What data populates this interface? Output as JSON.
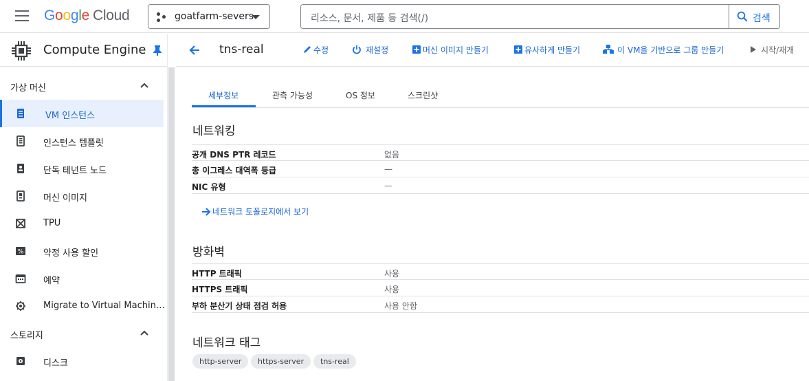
{
  "topbar": {
    "logo": {
      "g": "G",
      "o1": "o",
      "o2": "o",
      "g2": "g",
      "l": "l",
      "e": "e",
      "cloud": "Cloud"
    },
    "project": "goatfarm-severs",
    "search_placeholder": "리소스, 문서, 제품 등 검색(/)",
    "search_button": "검색"
  },
  "sidebar": {
    "product": "Compute Engine",
    "sections": [
      {
        "title": "가상 머신"
      },
      {
        "title": "스토리지"
      }
    ],
    "items": [
      {
        "label": "VM 인스턴스",
        "icon": "vm-instance-icon"
      },
      {
        "label": "인스턴스 템플릿",
        "icon": "template-icon"
      },
      {
        "label": "단독 테넌트 노드",
        "icon": "sole-tenant-icon"
      },
      {
        "label": "머신 이미지",
        "icon": "machine-image-icon"
      },
      {
        "label": "TPU",
        "icon": "tpu-icon"
      },
      {
        "label": "약정 사용 할인",
        "icon": "discount-icon"
      },
      {
        "label": "예약",
        "icon": "calendar-icon"
      },
      {
        "label": "Migrate to Virtual Machin…",
        "icon": "migrate-icon"
      },
      {
        "label": "디스크",
        "icon": "disk-icon"
      }
    ]
  },
  "header": {
    "title": "tns-real",
    "actions": {
      "edit": "수정",
      "reset": "재설정",
      "create_image": "머신 이미지 만들기",
      "create_similar": "유사하게 만들기",
      "create_group": "이 VM을 기반으로 그룹 만들기",
      "start": "시작/재개"
    }
  },
  "tabs": [
    "세부정보",
    "관측 가능성",
    "OS 정보",
    "스크린샷"
  ],
  "networking": {
    "title": "네트워킹",
    "rows": [
      {
        "key": "공개 DNS PTR 레코드",
        "value": "없음"
      },
      {
        "key": "총 이그레스 대역폭 등급",
        "value": "—"
      },
      {
        "key": "NIC 유형",
        "value": "—"
      }
    ],
    "topology_link": "네트워크 토폴로지에서 보기"
  },
  "firewall": {
    "title": "방화벽",
    "rows": [
      {
        "key": "HTTP 트래픽",
        "value": "사용"
      },
      {
        "key": "HTTPS 트래픽",
        "value": "사용"
      },
      {
        "key": "부하 분산기 상태 점검 허용",
        "value": "사용 안함"
      }
    ]
  },
  "network_tags": {
    "title": "네트워크 태그",
    "tags": [
      "http-server",
      "https-server",
      "tns-real"
    ]
  },
  "colors": {
    "accent": "#1a73e8",
    "active_bg": "#e8f0fe"
  }
}
